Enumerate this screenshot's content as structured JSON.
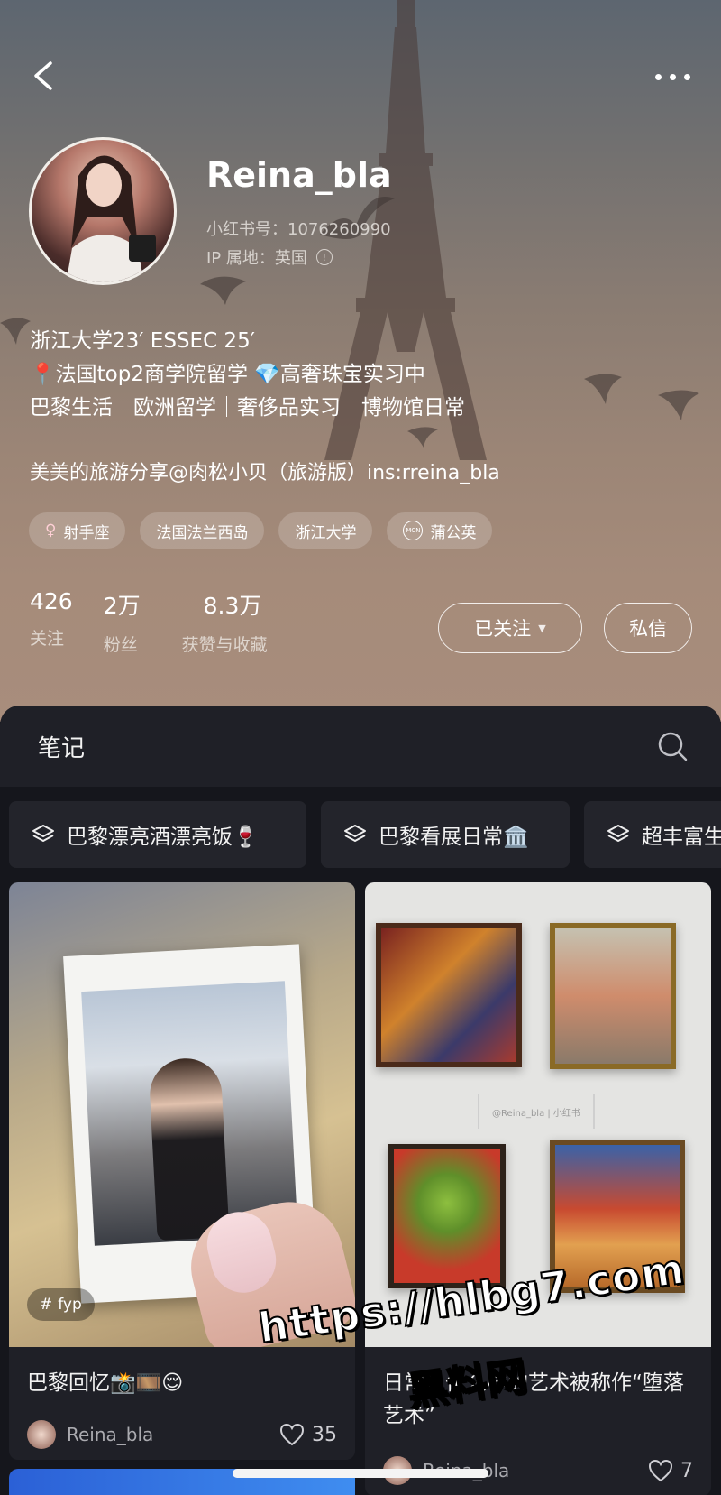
{
  "profile": {
    "name": "Reina_bla",
    "uid": "小红书号：1076260990",
    "ip": "IP 属地：英国",
    "bio": [
      "浙江大学23′ ESSEC 25′",
      "📍法国top2商学院留学 💎高奢珠宝实习中",
      "巴黎生活｜欧洲留学｜奢侈品实习｜博物馆日常"
    ],
    "bio_extra": "美美的旅游分享@肉松小贝（旅游版）ins:rreina_bla",
    "tags": [
      {
        "icon": "♀",
        "label": "射手座"
      },
      {
        "icon": "",
        "label": "法国法兰西岛"
      },
      {
        "icon": "",
        "label": "浙江大学"
      },
      {
        "icon": "MCN",
        "label": "蒲公英"
      }
    ],
    "stats": [
      {
        "num": "426",
        "label": "关注"
      },
      {
        "num": "2万",
        "label": "粉丝"
      },
      {
        "num": "8.3万",
        "label": "获赞与收藏"
      }
    ],
    "follow_label": "已关注",
    "message_label": "私信"
  },
  "notes": {
    "section_title": "笔记",
    "albums": [
      "巴黎漂亮酒漂亮饭🍷",
      "巴黎看展日常🏛️",
      "超丰富生"
    ],
    "cards": [
      {
        "badge": "fyp",
        "title": "巴黎回忆📸🎞️😌",
        "author": "Reina_bla",
        "likes": "35"
      },
      {
        "watermark": "@Reina_bla | 小红书",
        "title": "日常：什么样的艺术被称作“堕落艺术”",
        "author": "Reina_bla",
        "likes": "7"
      }
    ]
  },
  "overlay": {
    "url": "https://hlbg7.com",
    "site": "黑料网"
  },
  "colors": {
    "panel": "#15161c",
    "card": "#1f2027",
    "hero_top": "#5d6670",
    "hero_bottom": "#a88d7c"
  }
}
